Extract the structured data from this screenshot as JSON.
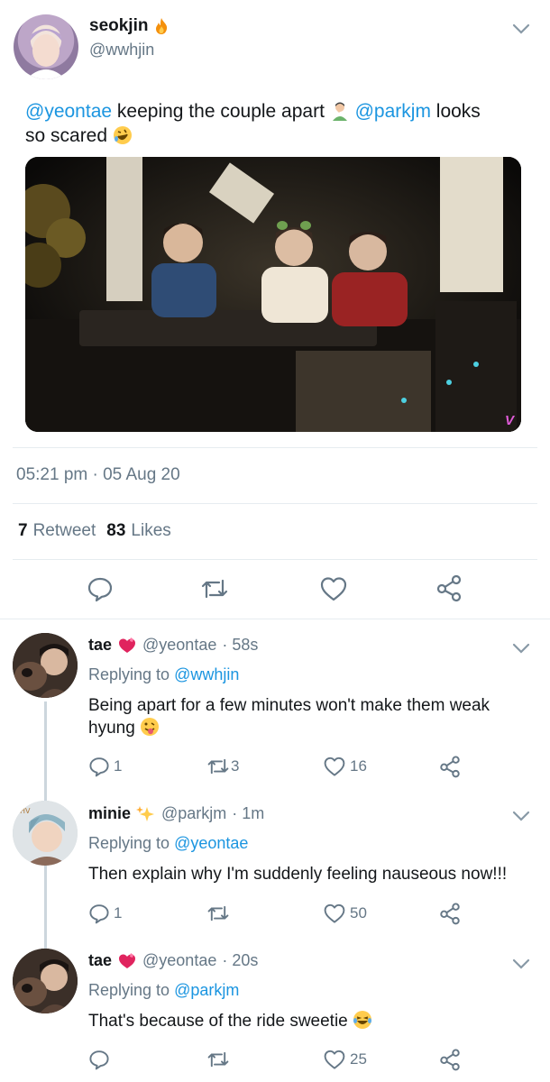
{
  "main_tweet": {
    "display_name": "seokjin",
    "handle": "@wwhjin",
    "text_parts": [
      "@yeontae",
      "keeping the couple apart",
      "@parkjm",
      "looks",
      "so scared"
    ],
    "timestamp": "05:21 pm · 05 Aug 20",
    "retweets_count": "7",
    "retweets_label": "Retweet",
    "likes_count": "83",
    "likes_label": "Likes",
    "media_alt": "V"
  },
  "replies": [
    {
      "display_name": "tae",
      "handle": "@yeontae",
      "time": "· 58s",
      "replying_label": "Replying to",
      "replying_to": "@wwhjin",
      "text_line1": "Being apart for a few minutes won't make them weak",
      "text_line2": "hyung",
      "replies": "1",
      "retweets": "3",
      "likes": "16"
    },
    {
      "display_name": "minie",
      "handle": "@parkjm",
      "time": "· 1m",
      "replying_label": "Replying to",
      "replying_to": "@yeontae",
      "text_line1": "Then explain why I'm suddenly feeling nauseous now!!!",
      "replies": "1",
      "retweets": "",
      "likes": "50"
    },
    {
      "display_name": "tae",
      "handle": "@yeontae",
      "time": "· 20s",
      "replying_label": "Replying to",
      "replying_to": "@parkjm",
      "text_line1": "That's because of the ride sweetie",
      "replies": "",
      "retweets": "",
      "likes": "25"
    }
  ],
  "colors": {
    "mention": "#1b95e0",
    "muted": "#657786",
    "divider": "#e6ecf0",
    "like_heart": "#e0245e"
  },
  "icons": [
    "fire-icon",
    "chevron-down-icon",
    "reply-icon",
    "retweet-icon",
    "heart-icon",
    "share-icon",
    "heart-emoji-icon",
    "sparkles-icon"
  ]
}
